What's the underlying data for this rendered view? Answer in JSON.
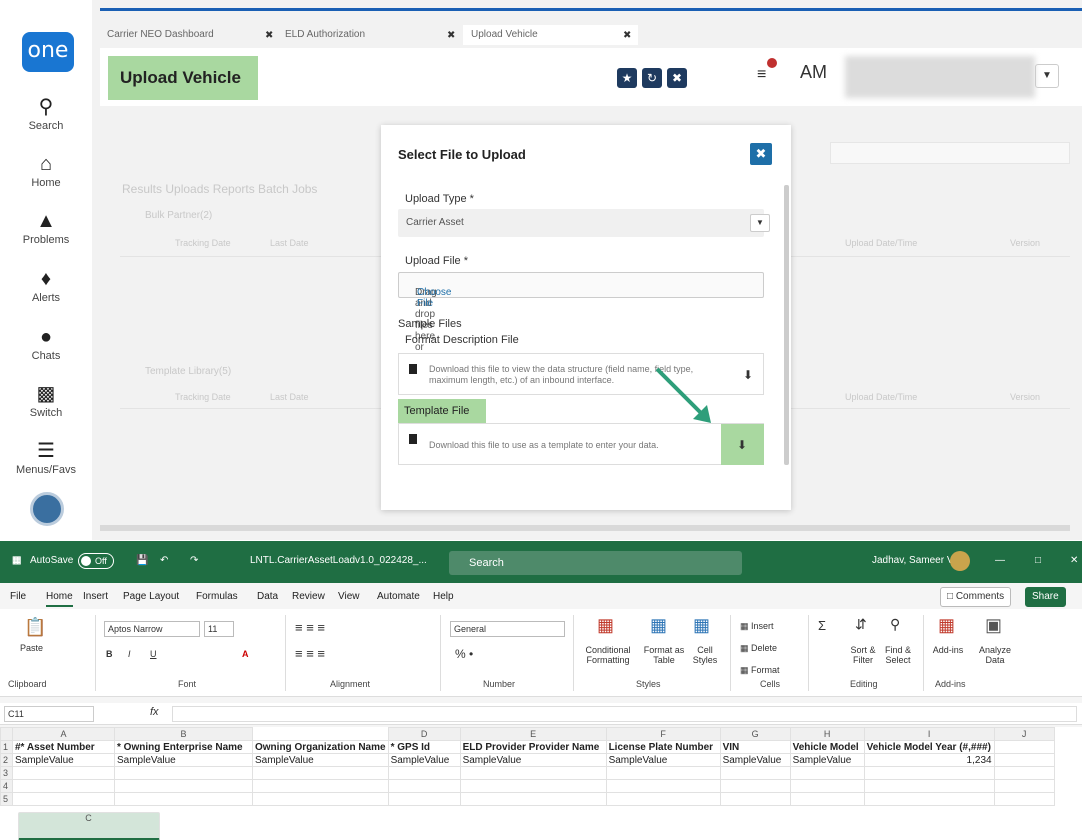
{
  "logo": "one",
  "nav": [
    {
      "label": "Search",
      "icon": "search-icon"
    },
    {
      "label": "Home",
      "icon": "home-icon"
    },
    {
      "label": "Problems",
      "icon": "warning-icon"
    },
    {
      "label": "Alerts",
      "icon": "bell-icon"
    },
    {
      "label": "Chats",
      "icon": "chat-icon"
    },
    {
      "label": "Switch",
      "icon": "switch-icon"
    },
    {
      "label": "Menus/Favs",
      "icon": "menu-icon"
    }
  ],
  "tabs": [
    "Carrier NEO Dashboard",
    "ELD Authorization",
    "Upload Vehicle"
  ],
  "header": {
    "title": "Upload Vehicle",
    "avatar": "AM"
  },
  "bg": {
    "tabs_text": "Results  Uploads  Reports  Batch Jobs",
    "group1": "Bulk Partner(2)",
    "group2": "Template Library(5)",
    "col1": "Tracking Date",
    "col2": "Last Date",
    "col3": "Upload Date/Time",
    "col4": "Version"
  },
  "modal": {
    "title": "Select File to Upload",
    "upload_type_label": "Upload Type *",
    "upload_type_value": "Carrier Asset",
    "upload_file_label": "Upload File *",
    "drop_text": "Drag and drop files here or",
    "choose_file": "Choose File",
    "sample_files": "Sample Files",
    "format_desc_label": "Format Description File",
    "format_desc_text": "Download this file to view the data structure (field name, field type, maximum length, etc.) of an inbound interface.",
    "template_label": "Template File",
    "template_text": "Download this file to use as a template to enter your data."
  },
  "excel": {
    "autosave": "AutoSave",
    "autosave_state": "Off",
    "filename": "LNTL.CarrierAssetLoadv1.0_022428_...",
    "search": "Search",
    "user": "Jadhav, Sameer V.",
    "menu": [
      "File",
      "Home",
      "Insert",
      "Page Layout",
      "Formulas",
      "Data",
      "Review",
      "View",
      "Automate",
      "Help"
    ],
    "comments": "Comments",
    "share": "Share",
    "font_name": "Aptos Narrow",
    "font_size": "11",
    "number_format": "General",
    "groups": [
      "Clipboard",
      "Font",
      "Alignment",
      "Number",
      "Styles",
      "Cells",
      "Editing",
      "Add-ins"
    ],
    "ribbon": {
      "paste": "Paste",
      "cond": "Conditional Formatting",
      "fmt_table": "Format as Table",
      "cell_styles": "Cell Styles",
      "insert": "Insert",
      "delete": "Delete",
      "format": "Format",
      "sort": "Sort & Filter",
      "find": "Find & Select",
      "addins": "Add-ins",
      "analyze": "Analyze Data"
    },
    "cell_ref": "C11",
    "fx": "fx",
    "columns": [
      "A",
      "B",
      "C",
      "D",
      "E",
      "F",
      "G",
      "H",
      "I",
      "J"
    ],
    "headers": [
      "#* Asset Number",
      "* Owning Enterprise Name",
      "Owning Organization Name",
      "* GPS Id",
      "ELD Provider Provider Name",
      "License Plate Number",
      "VIN",
      "Vehicle Model",
      "Vehicle Model Year (#,###)",
      ""
    ],
    "row2": [
      "SampleValue",
      "SampleValue",
      "SampleValue",
      "SampleValue",
      "SampleValue",
      "SampleValue",
      "SampleValue",
      "SampleValue",
      "1,234",
      ""
    ],
    "rownums": [
      "1",
      "2",
      "3",
      "4",
      "5"
    ]
  }
}
